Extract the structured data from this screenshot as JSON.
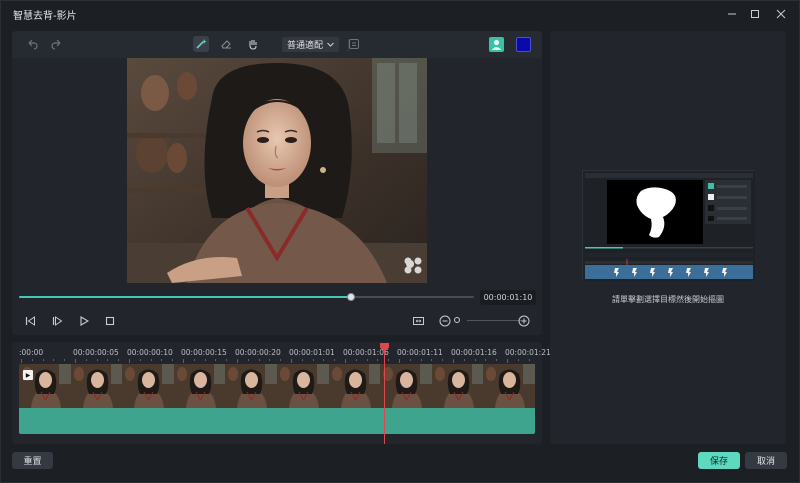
{
  "window": {
    "title": "智慧去背-影片",
    "minimize_icon": "minimize-icon",
    "maximize_icon": "maximize-icon",
    "close_icon": "close-icon"
  },
  "toolbar": {
    "undo_icon": "undo-icon",
    "redo_icon": "redo-icon",
    "smart_brush_icon": "magic-brush-icon",
    "eraser_icon": "eraser-icon",
    "hand_icon": "hand-icon",
    "mode_label": "普通適配",
    "mode_chevron_icon": "chevron-down-icon",
    "text_icon": "text-box-icon",
    "avatar_icon": "person-icon",
    "mask_color": "#0a0aa8"
  },
  "player": {
    "progress": 0.73,
    "timecode": "00:00:01:10",
    "prev_frame_icon": "step-backward-icon",
    "next_frame_icon": "step-forward-icon",
    "play_icon": "play-icon",
    "stop_icon": "stop-icon",
    "fit_icon": "fit-screen-icon",
    "zoom_out_icon": "zoom-out-icon",
    "zoom_in_icon": "zoom-in-icon"
  },
  "timeline": {
    "ruler": [
      ":00:00",
      "00:00:00:05",
      "00:00:00:10",
      "00:00:00:15",
      "00:00:00:20",
      "00:00:01:01",
      "00:00:01:06",
      "00:00:01:11",
      "00:00:01:16",
      "00:00:01:21"
    ],
    "frame_count": 10,
    "track_color": "#3fa48d",
    "playhead_color": "#e0474c"
  },
  "right_panel": {
    "hint": "請單擊劃選擇目標然後開始摳圖"
  },
  "footer": {
    "reset_label": "重置",
    "save_label": "保存",
    "cancel_label": "取消"
  },
  "colors": {
    "accent": "#5ed8bf",
    "background": "#1c1f24"
  }
}
